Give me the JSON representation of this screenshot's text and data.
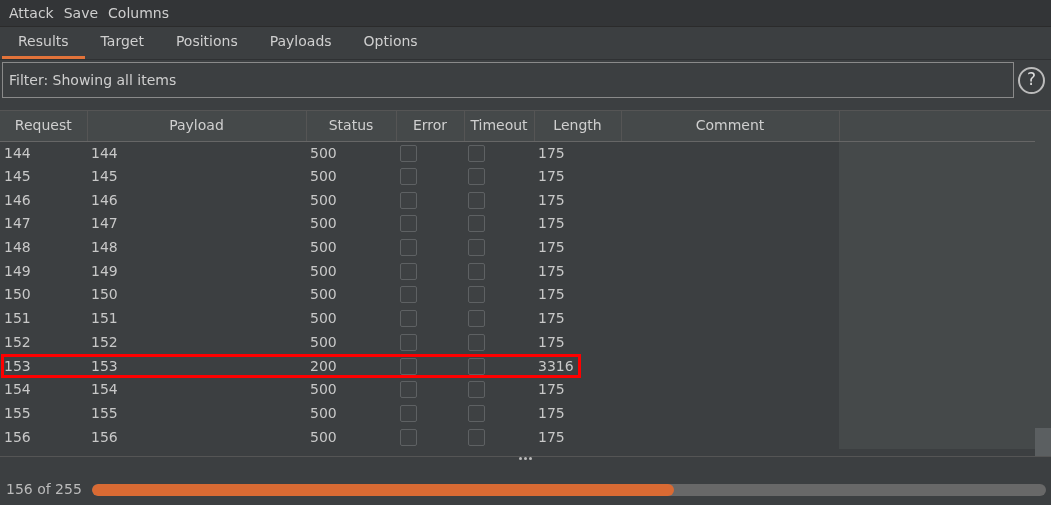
{
  "menu": [
    "Attack",
    "Save",
    "Columns"
  ],
  "tabs": [
    {
      "label": "Results",
      "selected": true
    },
    {
      "label": "Target",
      "selected": false
    },
    {
      "label": "Positions",
      "selected": false
    },
    {
      "label": "Payloads",
      "selected": false
    },
    {
      "label": "Options",
      "selected": false
    }
  ],
  "filter": {
    "value": "Filter: Showing all items",
    "help": "?"
  },
  "table": {
    "columns": [
      "Request",
      "Payload",
      "Status",
      "Error",
      "Timeout",
      "Length",
      "Comment"
    ],
    "rows": [
      {
        "request": "144",
        "payload": "144",
        "status": "500",
        "error": false,
        "timeout": false,
        "length": "175",
        "highlighted": false
      },
      {
        "request": "145",
        "payload": "145",
        "status": "500",
        "error": false,
        "timeout": false,
        "length": "175",
        "highlighted": false
      },
      {
        "request": "146",
        "payload": "146",
        "status": "500",
        "error": false,
        "timeout": false,
        "length": "175",
        "highlighted": false
      },
      {
        "request": "147",
        "payload": "147",
        "status": "500",
        "error": false,
        "timeout": false,
        "length": "175",
        "highlighted": false
      },
      {
        "request": "148",
        "payload": "148",
        "status": "500",
        "error": false,
        "timeout": false,
        "length": "175",
        "highlighted": false
      },
      {
        "request": "149",
        "payload": "149",
        "status": "500",
        "error": false,
        "timeout": false,
        "length": "175",
        "highlighted": false
      },
      {
        "request": "150",
        "payload": "150",
        "status": "500",
        "error": false,
        "timeout": false,
        "length": "175",
        "highlighted": false
      },
      {
        "request": "151",
        "payload": "151",
        "status": "500",
        "error": false,
        "timeout": false,
        "length": "175",
        "highlighted": false
      },
      {
        "request": "152",
        "payload": "152",
        "status": "500",
        "error": false,
        "timeout": false,
        "length": "175",
        "highlighted": false
      },
      {
        "request": "153",
        "payload": "153",
        "status": "200",
        "error": false,
        "timeout": false,
        "length": "3316",
        "highlighted": true
      },
      {
        "request": "154",
        "payload": "154",
        "status": "500",
        "error": false,
        "timeout": false,
        "length": "175",
        "highlighted": false
      },
      {
        "request": "155",
        "payload": "155",
        "status": "500",
        "error": false,
        "timeout": false,
        "length": "175",
        "highlighted": false
      },
      {
        "request": "156",
        "payload": "156",
        "status": "500",
        "error": false,
        "timeout": false,
        "length": "175",
        "highlighted": false
      }
    ]
  },
  "status_bar": {
    "progress_text": "156 of 255",
    "level": 0.61
  }
}
